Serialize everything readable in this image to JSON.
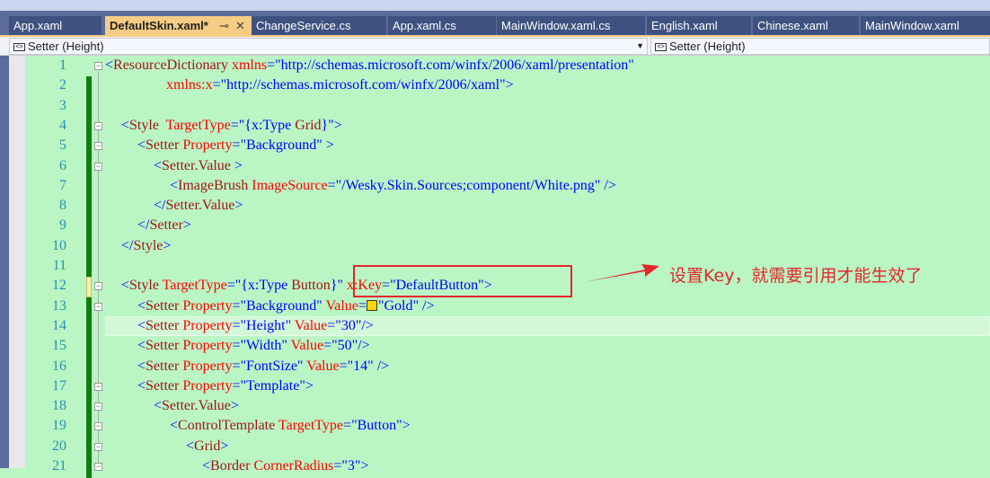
{
  "tabs": [
    {
      "label": "App.xaml"
    },
    {
      "label": "DefaultSkin.xaml*",
      "active": true
    },
    {
      "label": "ChangeService.cs"
    },
    {
      "label": "App.xaml.cs"
    },
    {
      "label": "MainWindow.xaml.cs"
    },
    {
      "label": "English.xaml"
    },
    {
      "label": "Chinese.xaml"
    },
    {
      "label": "MainWindow.xaml"
    }
  ],
  "active_tab_icons": {
    "pin": "⊸",
    "close": "✕"
  },
  "nav": {
    "left_combo": "Setter (Height)",
    "right_combo": "Setter (Height)",
    "icon": "<>"
  },
  "annotation": "设置Key，就需要引用才能生效了",
  "colors": {
    "background": "#b9f6c4",
    "annotation": "#e5262a",
    "tag": "#a31515",
    "attr": "#ff0000",
    "value": "#0000ff"
  },
  "code": {
    "lines": [
      {
        "n": "1",
        "indent": 0,
        "tokens": [
          [
            "p",
            "<"
          ],
          [
            "t",
            "ResourceDictionary"
          ],
          [
            "a",
            " xmlns"
          ],
          [
            "p",
            "="
          ],
          [
            "v",
            "\"http://schemas.microsoft.com/winfx/2006/xaml/presentation\""
          ]
        ]
      },
      {
        "n": "2",
        "indent": 0,
        "tokens": [
          [
            "a",
            "                 xmlns:x"
          ],
          [
            "p",
            "="
          ],
          [
            "v",
            "\"http://schemas.microsoft.com/winfx/2006/xaml\""
          ],
          [
            "p",
            ">"
          ]
        ]
      },
      {
        "n": "3",
        "indent": 0,
        "tokens": []
      },
      {
        "n": "4",
        "indent": 1,
        "tokens": [
          [
            "p",
            "<"
          ],
          [
            "t",
            "Style"
          ],
          [
            "a",
            "  TargetType"
          ],
          [
            "p",
            "="
          ],
          [
            "v",
            "\"{x:Type "
          ],
          [
            "t",
            "Grid"
          ],
          [
            "v",
            "}\""
          ],
          [
            "p",
            ">"
          ]
        ]
      },
      {
        "n": "5",
        "indent": 2,
        "tokens": [
          [
            "p",
            "<"
          ],
          [
            "t",
            "Setter"
          ],
          [
            "a",
            " Property"
          ],
          [
            "p",
            "="
          ],
          [
            "v",
            "\"Background\""
          ],
          [
            "p",
            " >"
          ]
        ]
      },
      {
        "n": "6",
        "indent": 3,
        "tokens": [
          [
            "p",
            "<"
          ],
          [
            "t",
            "Setter.Value"
          ],
          [
            "p",
            " >"
          ]
        ]
      },
      {
        "n": "7",
        "indent": 4,
        "tokens": [
          [
            "p",
            "<"
          ],
          [
            "t",
            "ImageBrush"
          ],
          [
            "a",
            " ImageSource"
          ],
          [
            "p",
            "="
          ],
          [
            "v",
            "\"/Wesky.Skin.Sources;component/White.png\""
          ],
          [
            "p",
            " />"
          ]
        ]
      },
      {
        "n": "8",
        "indent": 3,
        "tokens": [
          [
            "p",
            "</"
          ],
          [
            "t",
            "Setter.Value"
          ],
          [
            "p",
            ">"
          ]
        ]
      },
      {
        "n": "9",
        "indent": 2,
        "tokens": [
          [
            "p",
            "</"
          ],
          [
            "t",
            "Setter"
          ],
          [
            "p",
            ">"
          ]
        ]
      },
      {
        "n": "10",
        "indent": 1,
        "tokens": [
          [
            "p",
            "</"
          ],
          [
            "t",
            "Style"
          ],
          [
            "p",
            ">"
          ]
        ]
      },
      {
        "n": "11",
        "indent": 0,
        "tokens": []
      },
      {
        "n": "12",
        "indent": 1,
        "tokens": [
          [
            "p",
            "<"
          ],
          [
            "t",
            "Style"
          ],
          [
            "a",
            " TargetType"
          ],
          [
            "p",
            "="
          ],
          [
            "v",
            "\"{x:Type "
          ],
          [
            "t",
            "Button"
          ],
          [
            "v",
            "}\""
          ],
          [
            "a",
            " x:Key"
          ],
          [
            "p",
            "="
          ],
          [
            "v",
            "\"DefaultButton\""
          ],
          [
            "p",
            ">"
          ]
        ]
      },
      {
        "n": "13",
        "indent": 2,
        "tokens": [
          [
            "p",
            "<"
          ],
          [
            "t",
            "Setter"
          ],
          [
            "a",
            " Property"
          ],
          [
            "p",
            "="
          ],
          [
            "v",
            "\"Background\""
          ],
          [
            "a",
            " Value"
          ],
          [
            "p",
            "="
          ],
          [
            "sw",
            ""
          ],
          [
            "v",
            "\"Gold\""
          ],
          [
            "p",
            " />"
          ]
        ]
      },
      {
        "n": "14",
        "indent": 2,
        "tokens": [
          [
            "p",
            "<"
          ],
          [
            "t",
            "Setter"
          ],
          [
            "a",
            " Property"
          ],
          [
            "p",
            "="
          ],
          [
            "v",
            "\"Height\""
          ],
          [
            "a",
            " Value"
          ],
          [
            "p",
            "="
          ],
          [
            "v",
            "\"30\""
          ],
          [
            "p",
            "/>"
          ]
        ]
      },
      {
        "n": "15",
        "indent": 2,
        "tokens": [
          [
            "p",
            "<"
          ],
          [
            "t",
            "Setter"
          ],
          [
            "a",
            " Property"
          ],
          [
            "p",
            "="
          ],
          [
            "v",
            "\"Width\""
          ],
          [
            "a",
            " Value"
          ],
          [
            "p",
            "="
          ],
          [
            "v",
            "\"50\""
          ],
          [
            "p",
            "/>"
          ]
        ]
      },
      {
        "n": "16",
        "indent": 2,
        "tokens": [
          [
            "p",
            "<"
          ],
          [
            "t",
            "Setter"
          ],
          [
            "a",
            " Property"
          ],
          [
            "p",
            "="
          ],
          [
            "v",
            "\"FontSize\""
          ],
          [
            "a",
            " Value"
          ],
          [
            "p",
            "="
          ],
          [
            "v",
            "\"14\""
          ],
          [
            "p",
            " />"
          ]
        ]
      },
      {
        "n": "17",
        "indent": 2,
        "tokens": [
          [
            "p",
            "<"
          ],
          [
            "t",
            "Setter"
          ],
          [
            "a",
            " Property"
          ],
          [
            "p",
            "="
          ],
          [
            "v",
            "\"Template\""
          ],
          [
            "p",
            ">"
          ]
        ]
      },
      {
        "n": "18",
        "indent": 3,
        "tokens": [
          [
            "p",
            "<"
          ],
          [
            "t",
            "Setter.Value"
          ],
          [
            "p",
            ">"
          ]
        ]
      },
      {
        "n": "19",
        "indent": 4,
        "tokens": [
          [
            "p",
            "<"
          ],
          [
            "t",
            "ControlTemplate"
          ],
          [
            "a",
            " TargetType"
          ],
          [
            "p",
            "="
          ],
          [
            "v",
            "\"Button\""
          ],
          [
            "p",
            ">"
          ]
        ]
      },
      {
        "n": "20",
        "indent": 5,
        "tokens": [
          [
            "p",
            "<"
          ],
          [
            "t",
            "Grid"
          ],
          [
            "p",
            ">"
          ]
        ]
      },
      {
        "n": "21",
        "indent": 6,
        "tokens": [
          [
            "p",
            "<"
          ],
          [
            "t",
            "Border"
          ],
          [
            "a",
            " CornerRadius"
          ],
          [
            "p",
            "="
          ],
          [
            "v",
            "\"3\""
          ],
          [
            "p",
            ">"
          ]
        ]
      }
    ]
  }
}
